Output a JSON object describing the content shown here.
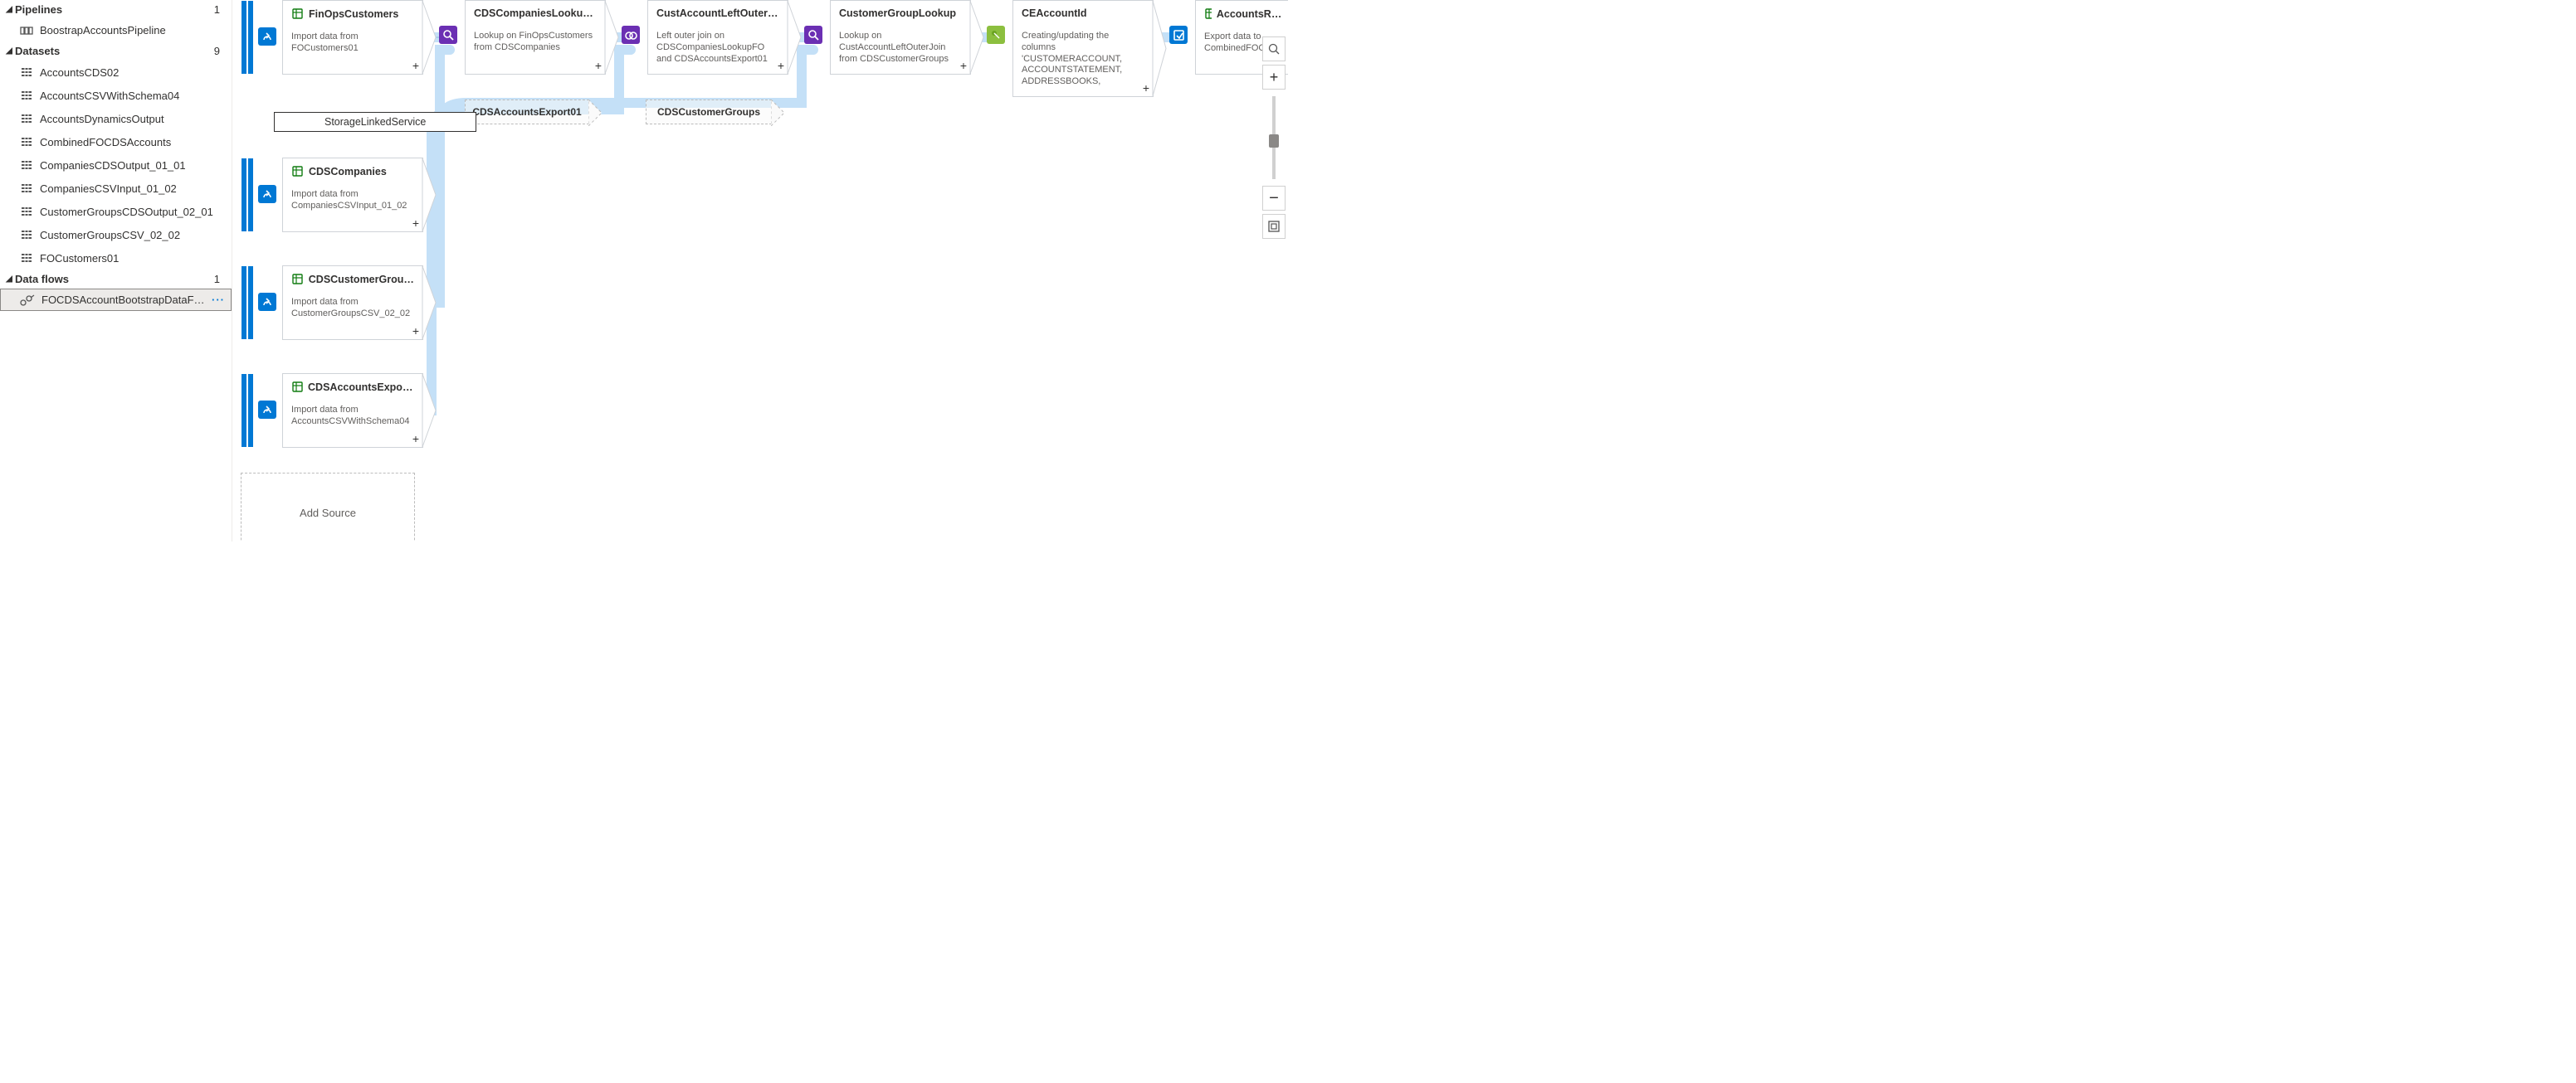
{
  "explorer": {
    "pipelines": {
      "label": "Pipelines",
      "count": "1",
      "items": [
        "BoostrapAccountsPipeline"
      ]
    },
    "datasets": {
      "label": "Datasets",
      "count": "9",
      "items": [
        "AccountsCDS02",
        "AccountsCSVWithSchema04",
        "AccountsDynamicsOutput",
        "CombinedFOCDSAccounts",
        "CompaniesCDSOutput_01_01",
        "CompaniesCSVInput_01_02",
        "CustomerGroupsCDSOutput_02_01",
        "CustomerGroupsCSV_02_02",
        "FOCustomers01"
      ]
    },
    "dataflows": {
      "label": "Data flows",
      "count": "1",
      "items": [
        "FOCDSAccountBootstrapDataF…"
      ]
    }
  },
  "flow": {
    "sources": [
      {
        "name": "FinOpsCustomers",
        "desc": "Import data from FOCustomers01"
      },
      {
        "name": "CDSCompanies",
        "desc": "Import data from CompaniesCSVInput_01_02"
      },
      {
        "name": "CDSCustomerGroups",
        "desc": "Import data from CustomerGroupsCSV_02_02"
      },
      {
        "name": "CDSAccountsExport01",
        "desc": "Import data from AccountsCSVWithSchema04"
      }
    ],
    "transforms": [
      {
        "name": "CDSCompaniesLookupFO",
        "desc": "Lookup on FinOpsCustomers from CDSCompanies",
        "kind": "lookup"
      },
      {
        "name": "CustAccountLeftOuterJ…",
        "desc": "Left outer join on CDSCompaniesLookupFO and CDSAccountsExport01",
        "kind": "join"
      },
      {
        "name": "CustomerGroupLookup",
        "desc": "Lookup on CustAccountLeftOuterJoin from CDSCustomerGroups",
        "kind": "lookup"
      },
      {
        "name": "CEAccountId",
        "desc": "Creating/updating the columns 'CUSTOMERACCOUNT, ACCOUNTSTATEMENT, ADDRESSBOOKS,",
        "kind": "derive"
      },
      {
        "name": "AccountsReadyForCDS",
        "desc": "Export data to CombinedFOCDSAccounts",
        "kind": "sink"
      }
    ],
    "ghosts": [
      {
        "label": "CDSAccountsExport01"
      },
      {
        "label": "CDSCustomerGroups"
      }
    ],
    "tooltip": "StorageLinkedService",
    "add_source": "Add Source"
  }
}
